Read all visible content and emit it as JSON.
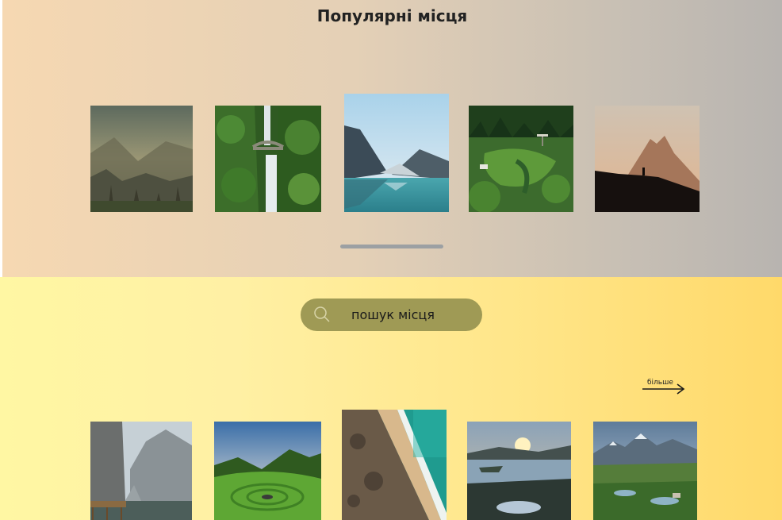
{
  "popular": {
    "title": "Популярні місця",
    "items": [
      {
        "icon": "misty-mountains-photo"
      },
      {
        "icon": "waterfall-bridge-photo"
      },
      {
        "icon": "mountain-lake-photo"
      },
      {
        "icon": "green-valley-photo"
      },
      {
        "icon": "mountain-silhouette-photo"
      }
    ]
  },
  "search": {
    "placeholder": "пошук місця",
    "icon": "search-icon"
  },
  "more": {
    "label": "більше",
    "icon": "arrow-right-icon"
  },
  "places": [
    {
      "icon": "cliff-lake-photo"
    },
    {
      "icon": "sunset-meadow-photo"
    },
    {
      "icon": "aerial-beach-photo"
    },
    {
      "icon": "sunset-lake-photo"
    },
    {
      "icon": "alpine-valley-photo"
    }
  ],
  "colors": {
    "top_gradient": [
      "#f6d8b2",
      "#b8b4b0"
    ],
    "bottom_gradient": [
      "#fff7a3",
      "#ffd96a"
    ],
    "search_pill": "#9f9a55",
    "scroll_indicator": "#9ca0a3"
  }
}
